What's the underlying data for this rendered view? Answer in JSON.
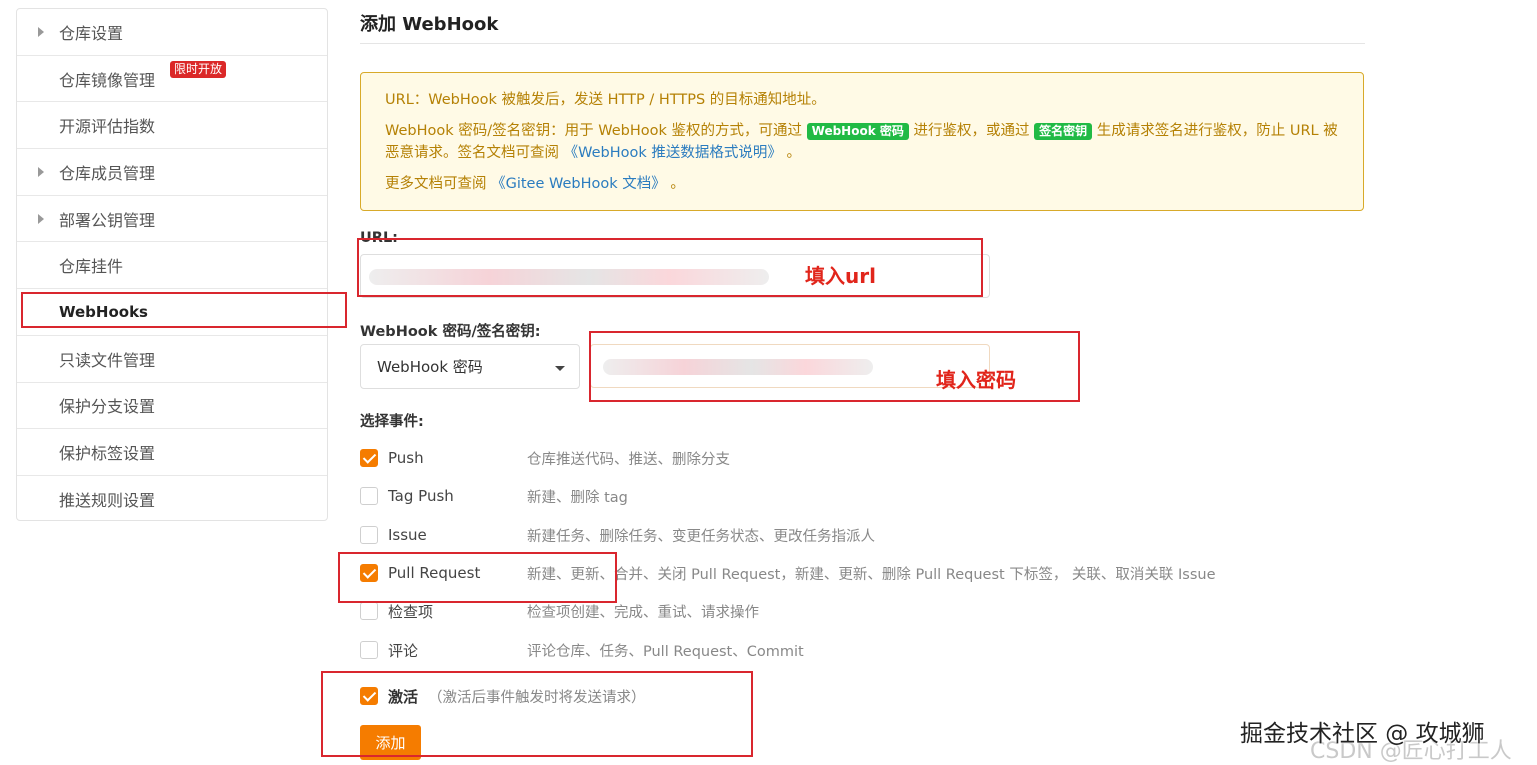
{
  "sidebar": {
    "items": [
      {
        "label": "仓库设置",
        "expandable": true
      },
      {
        "label": "仓库镜像管理",
        "expandable": false,
        "badge": "限时开放"
      },
      {
        "label": "开源评估指数",
        "expandable": false
      },
      {
        "label": "仓库成员管理",
        "expandable": true
      },
      {
        "label": "部署公钥管理",
        "expandable": true
      },
      {
        "label": "仓库挂件",
        "expandable": false
      },
      {
        "label": "WebHooks",
        "expandable": false,
        "active": true
      },
      {
        "label": "只读文件管理",
        "expandable": false
      },
      {
        "label": "保护分支设置",
        "expandable": false
      },
      {
        "label": "保护标签设置",
        "expandable": false
      },
      {
        "label": "推送规则设置",
        "expandable": false
      }
    ]
  },
  "main": {
    "title": "添加 WebHook",
    "notice": {
      "line1": "URL：WebHook 被触发后，发送 HTTP / HTTPS 的目标通知地址。",
      "line2_prefix": "WebHook 密码/签名密钥：用于 WebHook 鉴权的方式，可通过",
      "tag_password": "WebHook 密码",
      "line2_mid": "进行鉴权，或通过",
      "tag_signature": "签名密钥",
      "line2_suffix": "生成请求签名进行鉴权，防止 URL 被恶意请求。签名文档可查阅",
      "link_push_format": "《WebHook 推送数据格式说明》",
      "line2_end": "。",
      "line3_prefix": "更多文档可查阅",
      "link_gitee_docs": "《Gitee WebHook 文档》",
      "line3_end": "。"
    },
    "url_label": "URL:",
    "secret_label": "WebHook 密码/签名密钥:",
    "secret_type_selected": "WebHook 密码",
    "events_label": "选择事件:",
    "events": [
      {
        "name": "Push",
        "desc": "仓库推送代码、推送、删除分支",
        "checked": true
      },
      {
        "name": "Tag Push",
        "desc": "新建、删除 tag",
        "checked": false
      },
      {
        "name": "Issue",
        "desc": "新建任务、删除任务、变更任务状态、更改任务指派人",
        "checked": false
      },
      {
        "name": "Pull Request",
        "desc": "新建、更新、合并、关闭 Pull Request，新建、更新、删除 Pull Request 下标签， 关联、取消关联 Issue",
        "checked": true
      },
      {
        "name": "检查项",
        "desc": "检查项创建、完成、重试、请求操作",
        "checked": false
      },
      {
        "name": "评论",
        "desc": "评论仓库、任务、Pull Request、Commit",
        "checked": false
      }
    ],
    "activate_label": "激活",
    "activate_hint": "（激活后事件触发时将发送请求）",
    "activate_checked": true,
    "add_button": "添加"
  },
  "annotations": {
    "fill_url": "填入url",
    "fill_password": "填入密码"
  },
  "watermark": "掘金技术社区 @ 攻城狮",
  "watermark_faint": "CSDN @匠心打工人",
  "colors": {
    "accent_orange": "#f57c00",
    "annotation_red": "#d9262e",
    "notice_bg": "#fffae6",
    "notice_text": "#b58105",
    "tag_green": "#21ba45",
    "badge_red": "#db2828"
  }
}
